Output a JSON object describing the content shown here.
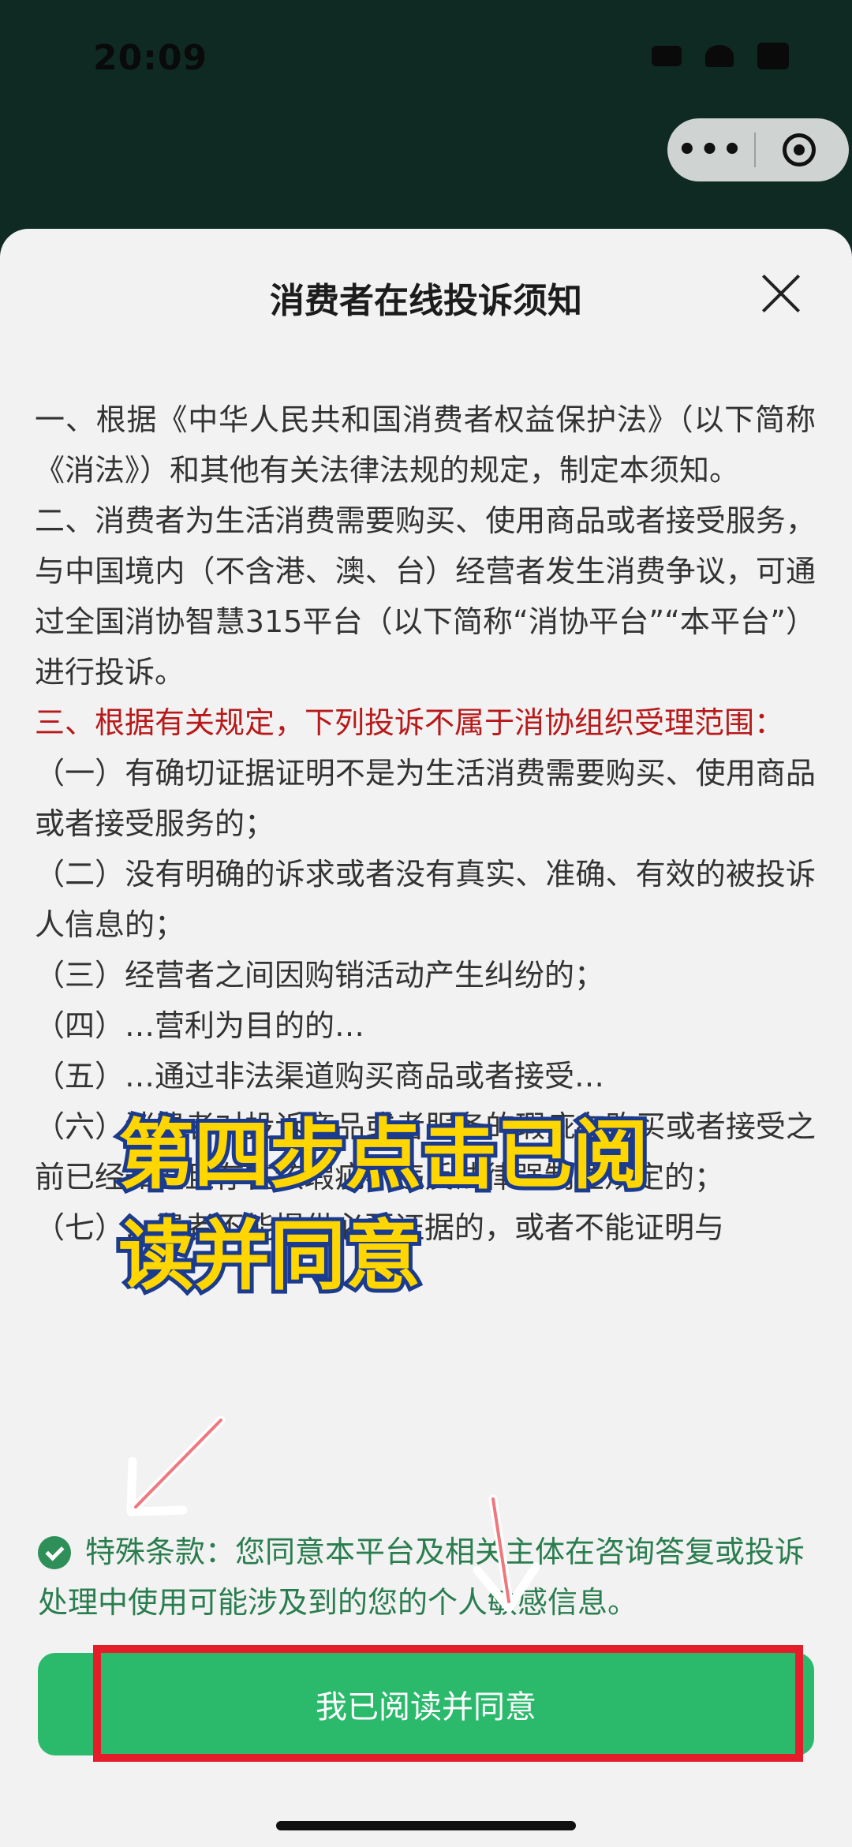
{
  "status": {
    "time": "20:09"
  },
  "capsule": {
    "more": "•••"
  },
  "sheet": {
    "title": "消费者在线投诉须知"
  },
  "notice": [
    {
      "text": "一、根据《中华人民共和国消费者权益保护法》（以下简称《消法》）和其他有关法律法规的规定，制定本须知。",
      "style": "normal"
    },
    {
      "text": "二、消费者为生活消费需要购买、使用商品或者接受服务，与中国境内（不含港、澳、台）经营者发生消费争议，可通过全国消协智慧315平台（以下简称“消协平台”“本平台”）进行投诉。",
      "style": "normal"
    },
    {
      "text": "三、根据有关规定，下列投诉不属于消协组织受理范围：",
      "style": "red"
    },
    {
      "text": "（一）有确切证据证明不是为生活消费需要购买、使用商品或者接受服务的；",
      "style": "normal"
    },
    {
      "text": "（二）没有明确的诉求或者没有真实、准确、有效的被投诉人信息的；",
      "style": "normal"
    },
    {
      "text": "（三）经营者之间因购销活动产生纠纷的；",
      "style": "normal"
    },
    {
      "text": "（四）…营利为目的的…",
      "style": "normal"
    },
    {
      "text": "（五）…通过非法渠道购买商品或者接受…",
      "style": "normal"
    },
    {
      "text": "（六）消费者对投诉商品或者服务的瑕疵在购买或者接受之前已经知道且存在该瑕疵不违反法律强制性规定的；",
      "style": "normal"
    },
    {
      "text": "（七）…费者不能提供必要证据的，或者不能证明与",
      "style": "normal"
    }
  ],
  "consent": {
    "text": "特殊条款：您同意本平台及相关主体在咨询答复或投诉处理中使用可能涉及到的您的个人敏感信息。"
  },
  "button": {
    "agree": "我已阅读并同意"
  },
  "overlay": {
    "caption_line1": "第四步点击已阅",
    "caption_line2": "读并同意"
  },
  "colors": {
    "header_bg": "#0f2a23",
    "sheet_bg": "#f2f2f2",
    "notice_red": "#b8191a",
    "consent_green": "#2a7d4f",
    "button_green": "#2bb96c",
    "highlight_red": "#e51d2a",
    "caption_yellow": "#ffd600"
  }
}
